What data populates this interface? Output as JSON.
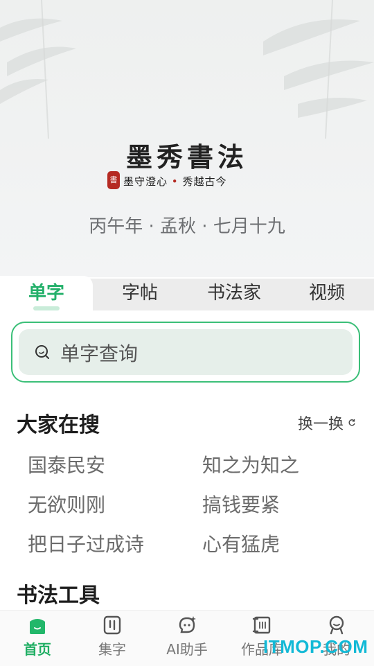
{
  "hero": {
    "logo_title": "墨秀書法",
    "seal_char": "書",
    "slogan_left": "墨守澄心",
    "slogan_dot": "•",
    "slogan_right": "秀越古今",
    "lunar_date": "丙午年 · 孟秋 · 七月十九"
  },
  "tabs": [
    {
      "label": "单字",
      "active": true
    },
    {
      "label": "字帖",
      "active": false
    },
    {
      "label": "书法家",
      "active": false
    },
    {
      "label": "视频",
      "active": false
    }
  ],
  "search": {
    "placeholder": "单字查询",
    "icon": "search-icon"
  },
  "popular": {
    "title": "大家在搜",
    "refresh_label": "换一换",
    "items": [
      "国泰民安",
      "知之为知之",
      "无欲则刚",
      "搞钱要紧",
      "把日子过成诗",
      "心有猛虎"
    ]
  },
  "tools": {
    "title": "书法工具"
  },
  "bottom_nav": [
    {
      "label": "首页",
      "icon": "home-icon",
      "active": true
    },
    {
      "label": "集字",
      "icon": "collect-chars-icon",
      "active": false
    },
    {
      "label": "AI助手",
      "icon": "ai-assistant-icon",
      "active": false
    },
    {
      "label": "作品库",
      "icon": "scroll-library-icon",
      "active": false
    },
    {
      "label": "我的",
      "icon": "profile-icon",
      "active": false
    }
  ],
  "watermark": "ITMOP.COM",
  "colors": {
    "accent": "#23b06a",
    "seal_red": "#b52a22",
    "search_border": "#3bbf78",
    "watermark": "#12b9d6"
  }
}
